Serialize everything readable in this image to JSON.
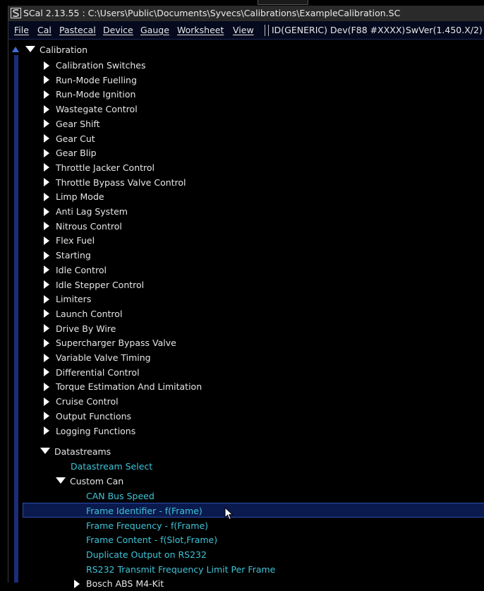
{
  "titlebar": {
    "text": "SCal 2.13.55  :  C:\\Users\\Public\\Documents\\Syvecs\\Calibrations\\ExampleCalibration.SC"
  },
  "menu": [
    {
      "label": "File"
    },
    {
      "label": "Cal"
    },
    {
      "label": "Pastecal"
    },
    {
      "label": "Device"
    },
    {
      "label": "Gauge"
    },
    {
      "label": "Worksheet"
    },
    {
      "label": "View"
    }
  ],
  "status": {
    "id": "ID(GENERIC)",
    "dev": "Dev(F88 #XXXX)",
    "swver": "SwVer(1.450.X/2)"
  },
  "tree": {
    "root": "Calibration",
    "items": [
      "Calibration Switches",
      "Run-Mode Fuelling",
      "Run-Mode Ignition",
      "Wastegate Control",
      "Gear Shift",
      "Gear Cut",
      "Gear Blip",
      "Throttle Jacker Control",
      "Throttle Bypass Valve Control",
      "Limp Mode",
      "Anti Lag System",
      "Nitrous Control",
      "Flex Fuel",
      "Starting",
      "Idle Control",
      "Idle Stepper Control",
      "Limiters",
      "Launch Control",
      "Drive By Wire",
      "Supercharger Bypass Valve",
      "Variable Valve Timing",
      "Differential Control",
      "Torque Estimation And Limitation",
      "Cruise Control",
      "Output Functions",
      "Logging Functions"
    ],
    "datastreams": {
      "label": "Datastreams",
      "select": "Datastream Select",
      "custom_can": "Custom Can",
      "can_items": [
        "CAN Bus Speed",
        "Frame Identifier - f(Frame)",
        "Frame Frequency - f(Frame)",
        "Frame Content - f(Slot,Frame)",
        "Duplicate Output on RS232",
        "RS232 Transmit Frequency Limit Per Frame"
      ],
      "bosch": "Bosch ABS M4-Kit"
    }
  },
  "colors": {
    "leaf": "#3ec4d8",
    "selection": "#0b1a4e",
    "menubar": "#050a1e"
  }
}
